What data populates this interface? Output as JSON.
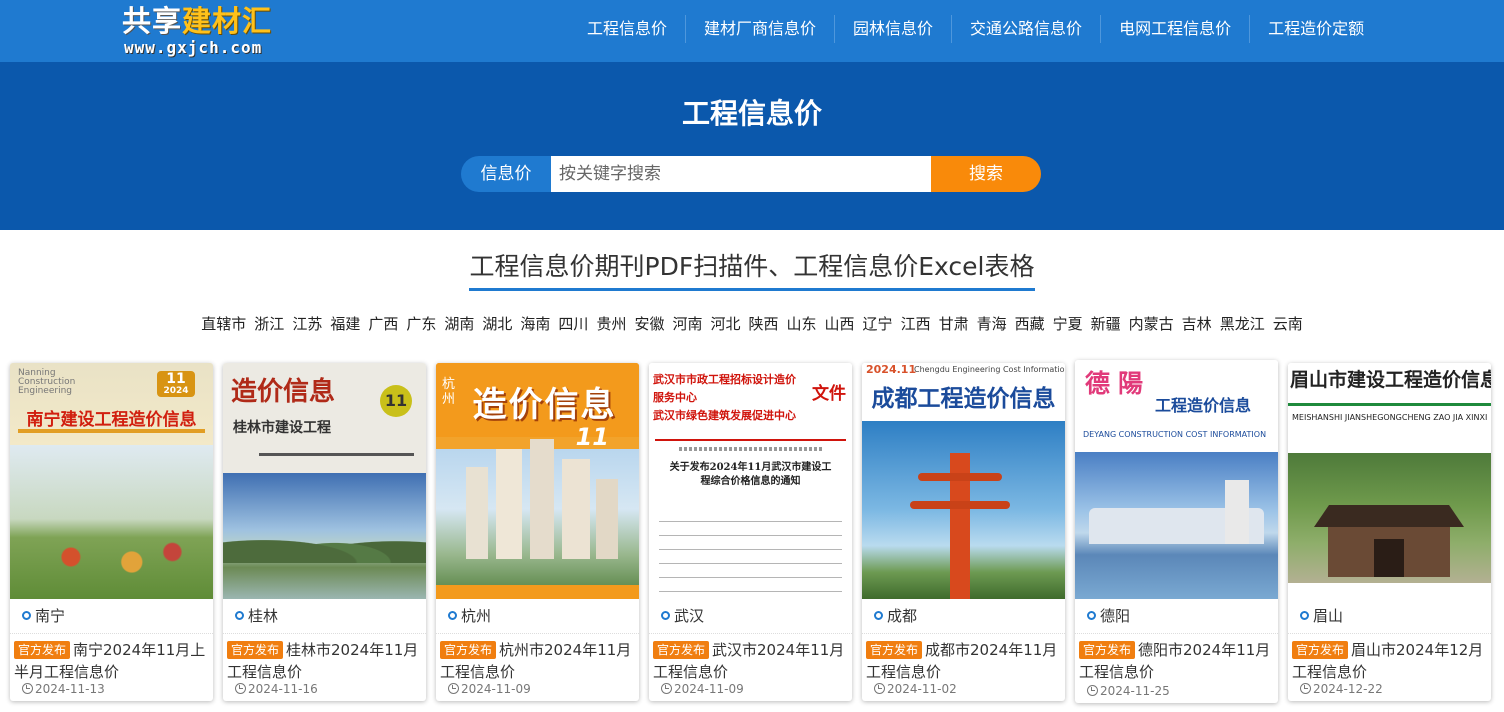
{
  "logo": {
    "text_white": "共享",
    "text_yellow": "建材汇",
    "url": "www.gxjch.com"
  },
  "nav": [
    "工程信息价",
    "建材厂商信息价",
    "园林信息价",
    "交通公路信息价",
    "电网工程信息价",
    "工程造价定额"
  ],
  "hero": {
    "title": "工程信息价"
  },
  "search": {
    "tag": "信息价",
    "placeholder": "按关键字搜索",
    "button": "搜索"
  },
  "section": {
    "title": "工程信息价期刊PDF扫描件、工程信息价Excel表格"
  },
  "regions": [
    "直辖市",
    "浙江",
    "江苏",
    "福建",
    "广西",
    "广东",
    "湖南",
    "湖北",
    "海南",
    "四川",
    "贵州",
    "安徽",
    "河南",
    "河北",
    "陕西",
    "山东",
    "山西",
    "辽宁",
    "江西",
    "甘肃",
    "青海",
    "西藏",
    "宁夏",
    "新疆",
    "内蒙古",
    "吉林",
    "黑龙江",
    "云南"
  ],
  "badge_label": "官方发布",
  "cards": [
    {
      "city": "南宁",
      "title": "南宁2024年11月上半月工程信息价",
      "date": "2024-11-13",
      "cover_title": "南宁建设工程造价信息",
      "cover_sub": "11",
      "cover_year": "2024"
    },
    {
      "city": "桂林",
      "title": "桂林市2024年11月工程信息价",
      "date": "2024-11-16",
      "cover_title": "造价信息",
      "cover_sub": "桂林市建设工程",
      "cover_badge": "11"
    },
    {
      "city": "杭州",
      "title": "杭州市2024年11月工程信息价",
      "date": "2024-11-09",
      "cover_title": "造价信息",
      "cover_side": "杭州",
      "cover_sub": "11"
    },
    {
      "city": "武汉",
      "title": "武汉市2024年11月工程信息价",
      "date": "2024-11-09",
      "cover_line1": "武汉市市政工程招标设计造价服务中心",
      "cover_line2": "武汉市绿色建筑发展促进中心",
      "cover_tag": "文件",
      "cover_notice": "关于发布2024年11月武汉市建设工程综合价格信息的通知"
    },
    {
      "city": "成都",
      "title": "成都市2024年11月工程信息价",
      "date": "2024-11-02",
      "cover_title": "成都工程造价信息",
      "cover_top": "2024.11",
      "cover_en": "Chengdu Engineering Cost Information"
    },
    {
      "city": "德阳",
      "title": "德阳市2024年11月工程信息价",
      "date": "2024-11-25",
      "cover_title": "工程造价信息",
      "cover_brand": "德陽",
      "cover_en": "DEYANG CONSTRUCTION COST INFORMATION"
    },
    {
      "city": "眉山",
      "title": "眉山市2024年12月工程信息价",
      "date": "2024-12-22",
      "cover_title": "眉山市建设工程造价信息",
      "cover_en": "MEISHANSHI JIANSHEGONGCHENG ZAO JIA XINXI"
    }
  ]
}
